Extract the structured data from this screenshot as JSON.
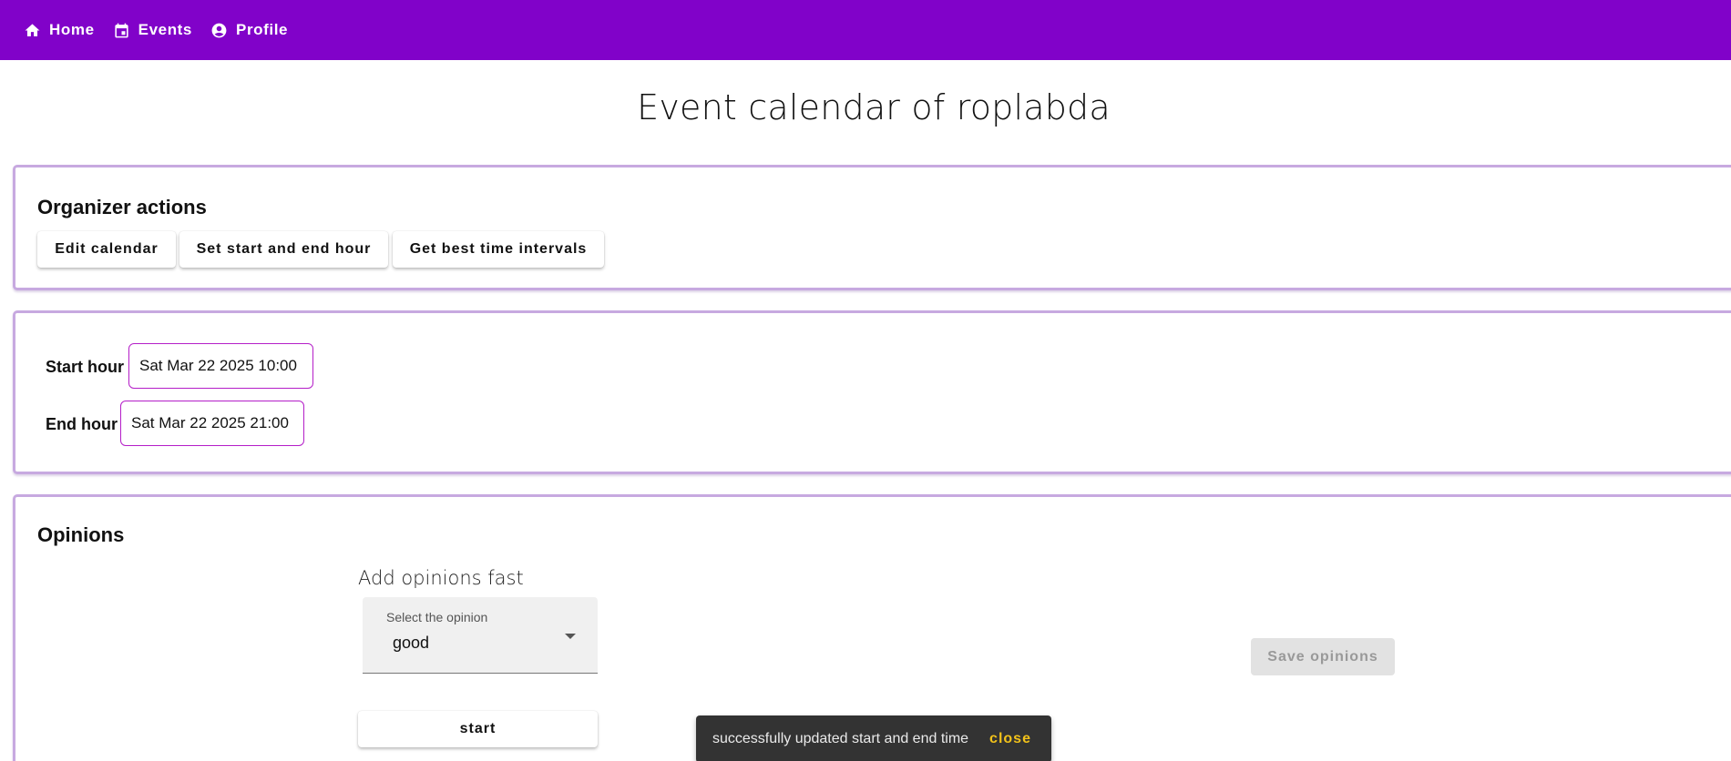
{
  "nav": {
    "home": {
      "label": "Home",
      "icon": "home-icon"
    },
    "events": {
      "label": "Events",
      "icon": "calendar-icon"
    },
    "profile": {
      "label": "Profile",
      "icon": "account-circle-icon"
    }
  },
  "page": {
    "title": "Event calendar of roplabda"
  },
  "organizer": {
    "title": "Organizer actions",
    "edit_calendar": "Edit calendar",
    "set_hours": "Set start and end hour",
    "best_intervals": "Get best time intervals"
  },
  "hours": {
    "start_label": "Start hour",
    "start_value": "Sat Mar 22 2025 10:00",
    "end_label": "End hour",
    "end_value": "Sat Mar 22 2025 21:00"
  },
  "opinions": {
    "title": "Opinions",
    "add_fast": "Add opinions fast",
    "select_label": "Select the opinion",
    "select_value": "good",
    "start_button": "start",
    "save_button": "Save opinions"
  },
  "snackbar": {
    "message": "successfully updated start and end time",
    "close": "close"
  },
  "colors": {
    "topbar": "#8102c9",
    "card_border": "#c7a9e0",
    "date_border": "#b41ec8",
    "snackbar_bg": "#333333",
    "snackbar_action": "#f2c21a"
  }
}
